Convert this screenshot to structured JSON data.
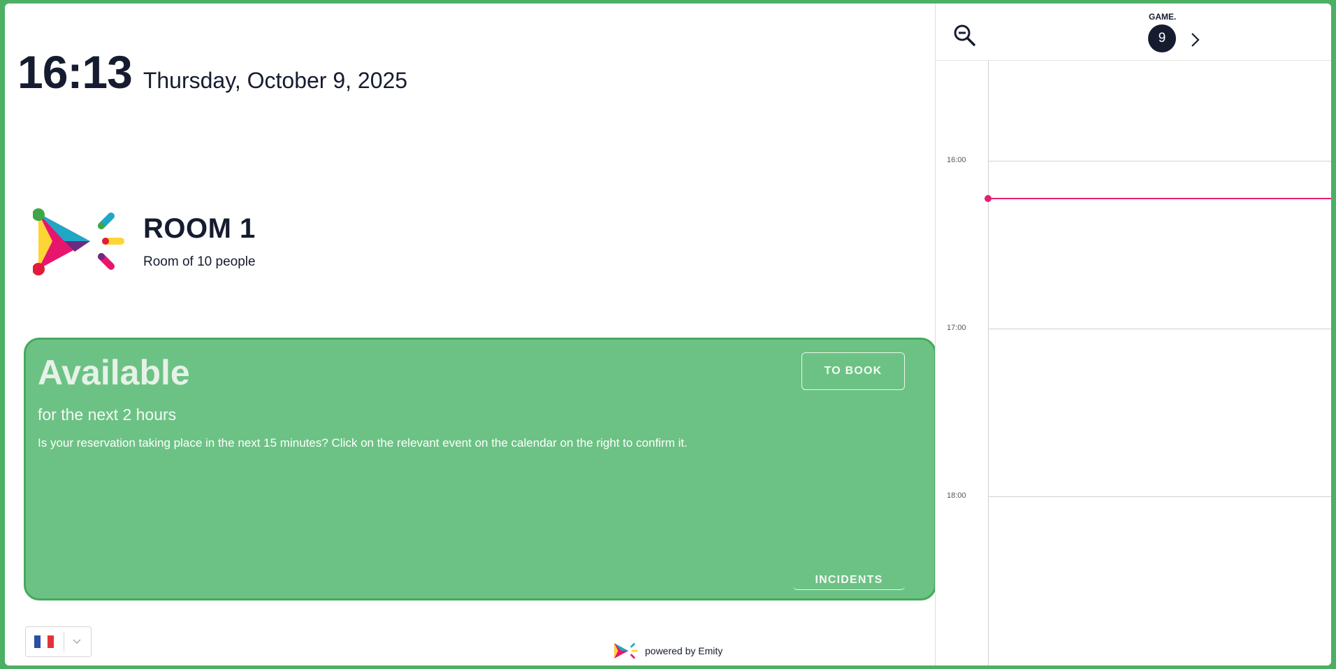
{
  "header": {
    "time": "16:13",
    "date": "Thursday, October 9, 2025"
  },
  "room": {
    "name": "ROOM 1",
    "capacity": "Room of 10 people"
  },
  "status": {
    "title": "Available",
    "duration": "for the next 2 hours",
    "message": "Is your reservation taking place in the next 15 minutes? Click on the relevant event on the calendar on the right to confirm it.",
    "book_label": "TO BOOK",
    "incidents_label": "INCIDENTS",
    "color": "#6cc284"
  },
  "language": {
    "selected": "fr-flag",
    "chevron_icon": "chevron-down-icon"
  },
  "footer": {
    "powered_by": "powered by Emity"
  },
  "calendar": {
    "day_name": "GAME.",
    "day_number": "9",
    "zoom_icon": "zoom-out-icon",
    "next_icon": "chevron-right-icon",
    "hours": [
      "16:00",
      "17:00",
      "18:00"
    ],
    "now_color": "#e41f73"
  }
}
